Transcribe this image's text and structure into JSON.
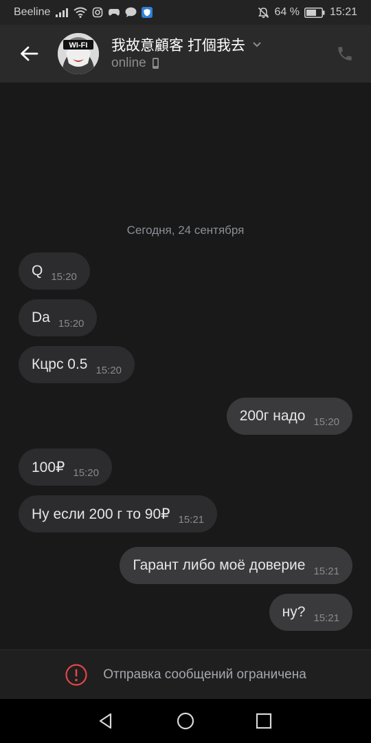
{
  "status_bar": {
    "carrier": "Beeline",
    "battery": "64 %",
    "time": "15:21"
  },
  "header": {
    "chat_name": "我故意顧客 打個我去",
    "status": "online",
    "avatar_text": "WI-FI"
  },
  "messages": {
    "date_separator": "Сегодня, 24 сентября",
    "items": [
      {
        "direction": "in",
        "text": "Q",
        "time": "15:20"
      },
      {
        "direction": "in",
        "text": "Da",
        "time": "15:20"
      },
      {
        "direction": "in",
        "text": "Кцрс 0.5",
        "time": "15:20"
      },
      {
        "direction": "out",
        "text": "200г надо",
        "time": "15:20"
      },
      {
        "direction": "in",
        "text": "100₽",
        "time": "15:20"
      },
      {
        "direction": "in",
        "text": "Ну если 200 г то 90₽",
        "time": "15:21"
      },
      {
        "direction": "out",
        "text": "Гарант либо моё доверие",
        "time": "15:21"
      },
      {
        "direction": "out",
        "text": "ну?",
        "time": "15:21"
      }
    ]
  },
  "restriction": {
    "text": "Отправка сообщений ограничена"
  },
  "colors": {
    "background": "#191919",
    "header": "#2a2a2a",
    "incoming_bubble": "#2c2c2e",
    "outgoing_bubble": "#3a3a3c",
    "warning_red": "#e64646"
  }
}
